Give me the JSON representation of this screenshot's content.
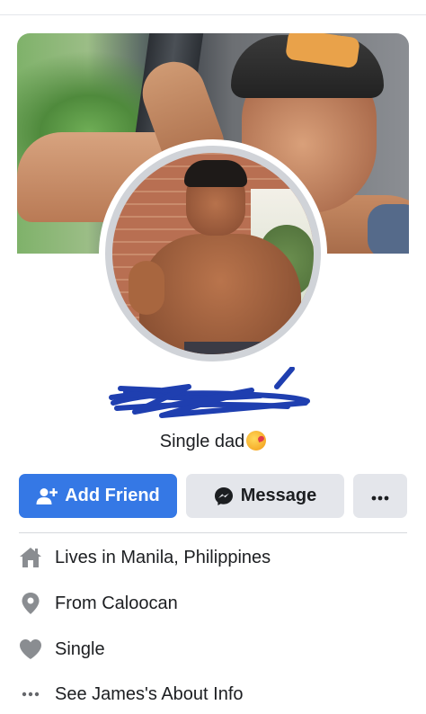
{
  "profile": {
    "bio": "Single dad"
  },
  "actions": {
    "add_friend": "Add Friend",
    "message": "Message",
    "more": "···"
  },
  "intro": {
    "lives_prefix": "Lives in ",
    "lives_place": "Manila, Philippines",
    "from_prefix": "From ",
    "from_place": "Caloocan",
    "relationship": "Single",
    "see_about": "See James's About Info"
  },
  "icons": {
    "add_friend": "person-plus-icon",
    "message": "messenger-icon",
    "more": "more-dots-icon",
    "lives": "home-icon",
    "from": "location-pin-icon",
    "relationship": "heart-icon",
    "about": "dots-icon",
    "bio_emoji": "kissing-face-emoji"
  },
  "colors": {
    "primary_button": "#3578e5",
    "secondary_button": "#e4e6eb",
    "icon_gray": "#65676b",
    "redaction": "#1f3fb0"
  }
}
